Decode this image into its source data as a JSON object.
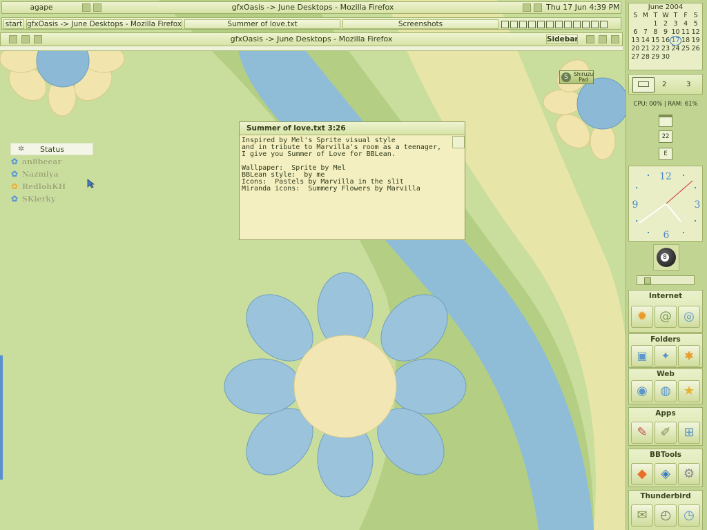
{
  "toolbar_top": {
    "workspace": "agape",
    "window_title": "gfxOasis -> June Desktops - Mozilla Firefox",
    "clock": "Thu 17 Jun 4:39 PM"
  },
  "taskbar": {
    "start": "start",
    "tasks": [
      "gfxOasis -> June Desktops - Mozilla Firefox",
      "Summer of love.txt",
      "Screenshots"
    ]
  },
  "window": {
    "title": "gfxOasis -> June Desktops - Mozilla Firefox",
    "sidebar_label": "Sidebar"
  },
  "note": {
    "title": "Summer of love.txt  3:26",
    "lines": [
      "Inspired by Mel's Sprite visual style",
      "and in tribute to Marvilla's room as a teenager,",
      "I give you Summer of Love for BBLean.",
      "",
      "Wallpaper:  Sprite by Mel",
      "BBLean style:  by me",
      "Icons:  Pastels by Marvilla in the slit",
      "Miranda icons:  Summery Flowers by Marvilla"
    ]
  },
  "contacts": {
    "status": "Status",
    "list": [
      "an8beear",
      "Nazmiya",
      "RedlohKH",
      "SKierky"
    ]
  },
  "calendar": {
    "month": "June 2004",
    "days": [
      "S",
      "M",
      "T",
      "W",
      "T",
      "F",
      "S"
    ],
    "weeks": [
      [
        "",
        "",
        "1",
        "2",
        "3",
        "4",
        "5"
      ],
      [
        "6",
        "7",
        "8",
        "9",
        "10",
        "11",
        "12"
      ],
      [
        "13",
        "14",
        "15",
        "16",
        "17",
        "18",
        "19"
      ],
      [
        "20",
        "21",
        "22",
        "23",
        "24",
        "25",
        "26"
      ],
      [
        "27",
        "28",
        "29",
        "30",
        "",
        "",
        ""
      ]
    ],
    "today": "17"
  },
  "workspaces": [
    "2",
    "3"
  ],
  "sysmon": "CPU: 00% | RAM: 61%",
  "date_badge": "22",
  "e_badge": "E",
  "clock_numbers": {
    "n12": "12",
    "n3": "3",
    "n6": "6",
    "n9": "9"
  },
  "shiruzu": {
    "line1": "Shiruzu",
    "line2": "Pad"
  },
  "ball_number": "8",
  "groups": [
    "Internet",
    "Folders",
    "Web",
    "Apps",
    "BBTools",
    "Thunderbird"
  ],
  "colors": {
    "accent": "#5d96c8",
    "bar": "#dfe9b6",
    "petal": "#8fb8d6",
    "sun": "#f2e7b4"
  }
}
